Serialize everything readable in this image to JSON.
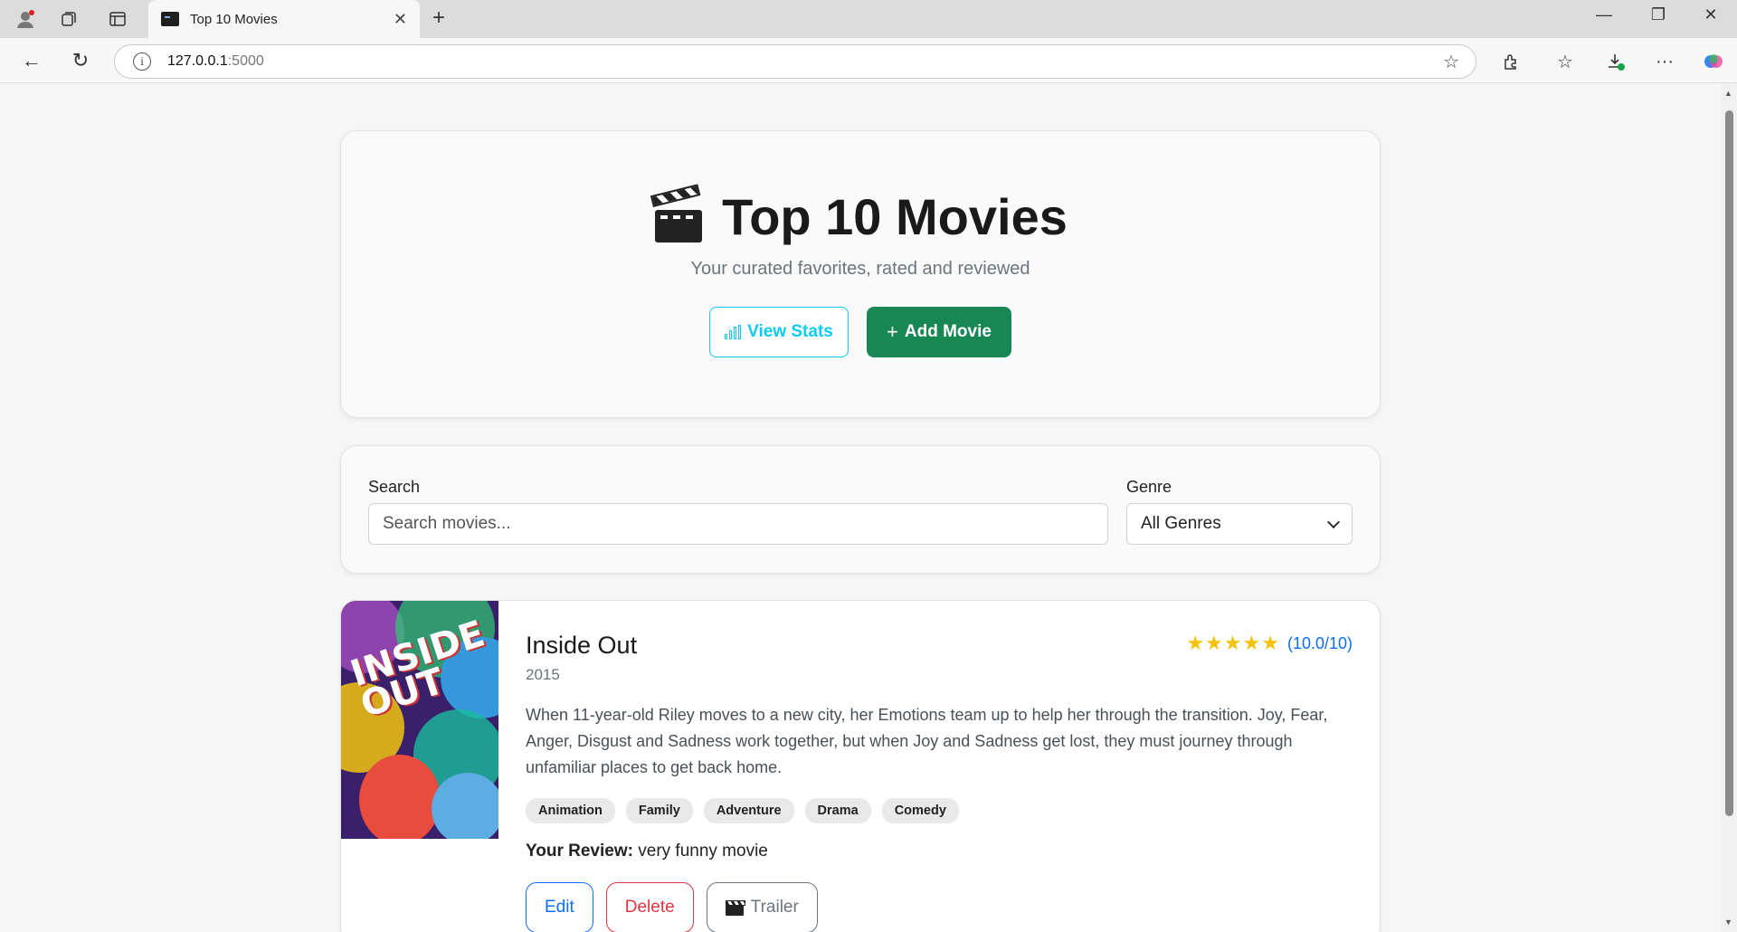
{
  "browser": {
    "tab_title": "Top 10 Movies",
    "url_host": "127.0.0.1",
    "url_port": ":5000"
  },
  "hero": {
    "title": "Top 10 Movies",
    "subtitle": "Your curated favorites, rated and reviewed",
    "view_stats_label": "View Stats",
    "add_movie_label": "Add Movie"
  },
  "filters": {
    "search_label": "Search",
    "search_placeholder": "Search movies...",
    "search_value": "",
    "genre_label": "Genre",
    "genre_selected": "All Genres"
  },
  "movies": [
    {
      "title": "Inside Out",
      "year": "2015",
      "rating_stars": 5,
      "rating_text": "(10.0/10)",
      "poster_text": "INSIDE OUT",
      "description": "When 11-year-old Riley moves to a new city, her Emotions team up to help her through the transition. Joy, Fear, Anger, Disgust and Sadness work together, but when Joy and Sadness get lost, they must journey through unfamiliar places to get back home.",
      "genres": [
        "Animation",
        "Family",
        "Adventure",
        "Drama",
        "Comedy"
      ],
      "review_label": "Your Review:",
      "review_text": "very funny movie",
      "edit_label": "Edit",
      "delete_label": "Delete",
      "trailer_label": "Trailer"
    }
  ],
  "colors": {
    "info": "#0dcaf0",
    "success": "#198754",
    "primary": "#0d6efd",
    "danger": "#dc3545",
    "star": "#f4c20d"
  }
}
